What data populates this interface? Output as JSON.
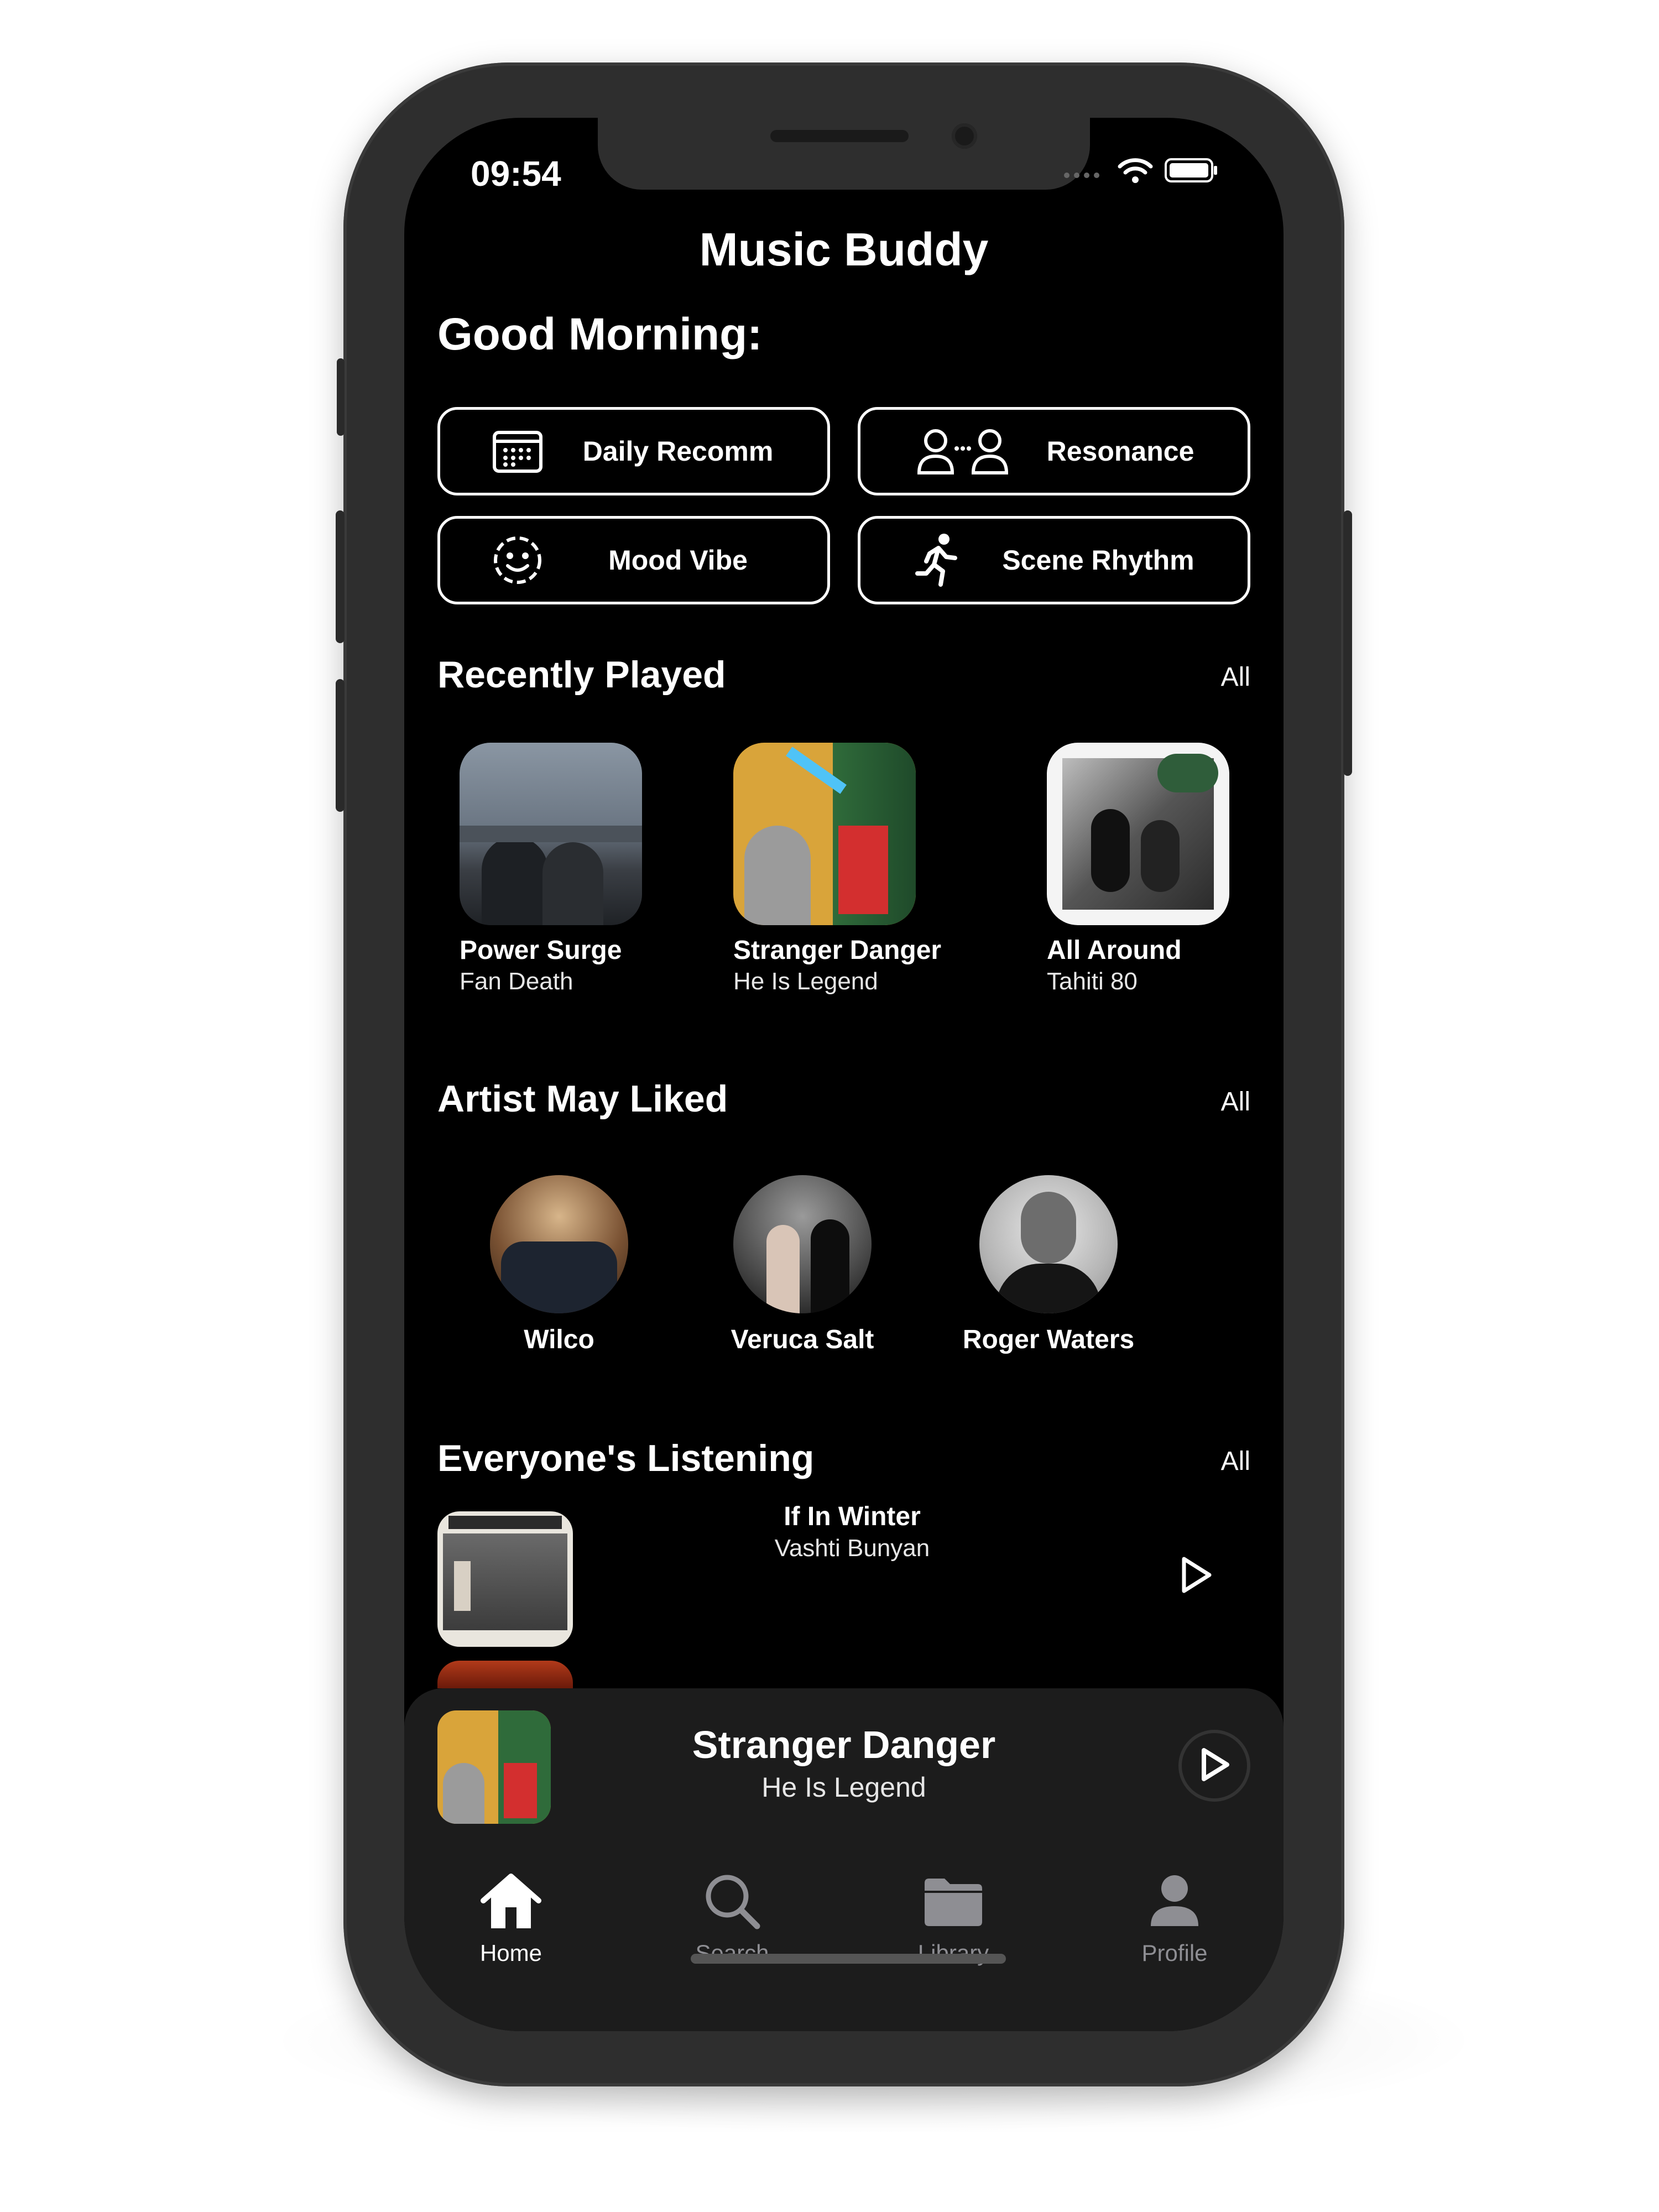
{
  "status": {
    "time": "09:54"
  },
  "header": {
    "title": "Music Buddy",
    "greeting": "Good Morning:"
  },
  "quick_actions": [
    {
      "label": "Daily Recomm",
      "icon": "calendar-icon"
    },
    {
      "label": "Resonance",
      "icon": "people-icon"
    },
    {
      "label": "Mood Vibe",
      "icon": "smiley-icon"
    },
    {
      "label": "Scene Rhythm",
      "icon": "running-icon"
    }
  ],
  "recently_played": {
    "title": "Recently Played",
    "all_label": "All",
    "items": [
      {
        "title": "Power Surge",
        "artist": "Fan Death"
      },
      {
        "title": "Stranger Danger",
        "artist": "He Is Legend"
      },
      {
        "title": "All Around",
        "artist": "Tahiti 80"
      }
    ]
  },
  "artists": {
    "title": "Artist May Liked",
    "all_label": "All",
    "items": [
      {
        "name": "Wilco"
      },
      {
        "name": "Veruca Salt"
      },
      {
        "name": "Roger Waters"
      }
    ]
  },
  "everyone": {
    "title": "Everyone's Listening",
    "all_label": "All",
    "items": [
      {
        "title": "If In Winter",
        "artist": "Vashti Bunyan"
      }
    ]
  },
  "now_playing": {
    "title": "Stranger Danger",
    "artist": "He Is Legend"
  },
  "tabs": [
    {
      "label": "Home",
      "icon": "home-icon",
      "active": true
    },
    {
      "label": "Search",
      "icon": "search-icon",
      "active": false
    },
    {
      "label": "Library",
      "icon": "folder-icon",
      "active": false
    },
    {
      "label": "Profile",
      "icon": "person-icon",
      "active": false
    }
  ],
  "colors": {
    "background": "#000000",
    "text": "#ffffff",
    "inactive_tab": "#8e8e93",
    "panel": "#1c1c1c"
  }
}
